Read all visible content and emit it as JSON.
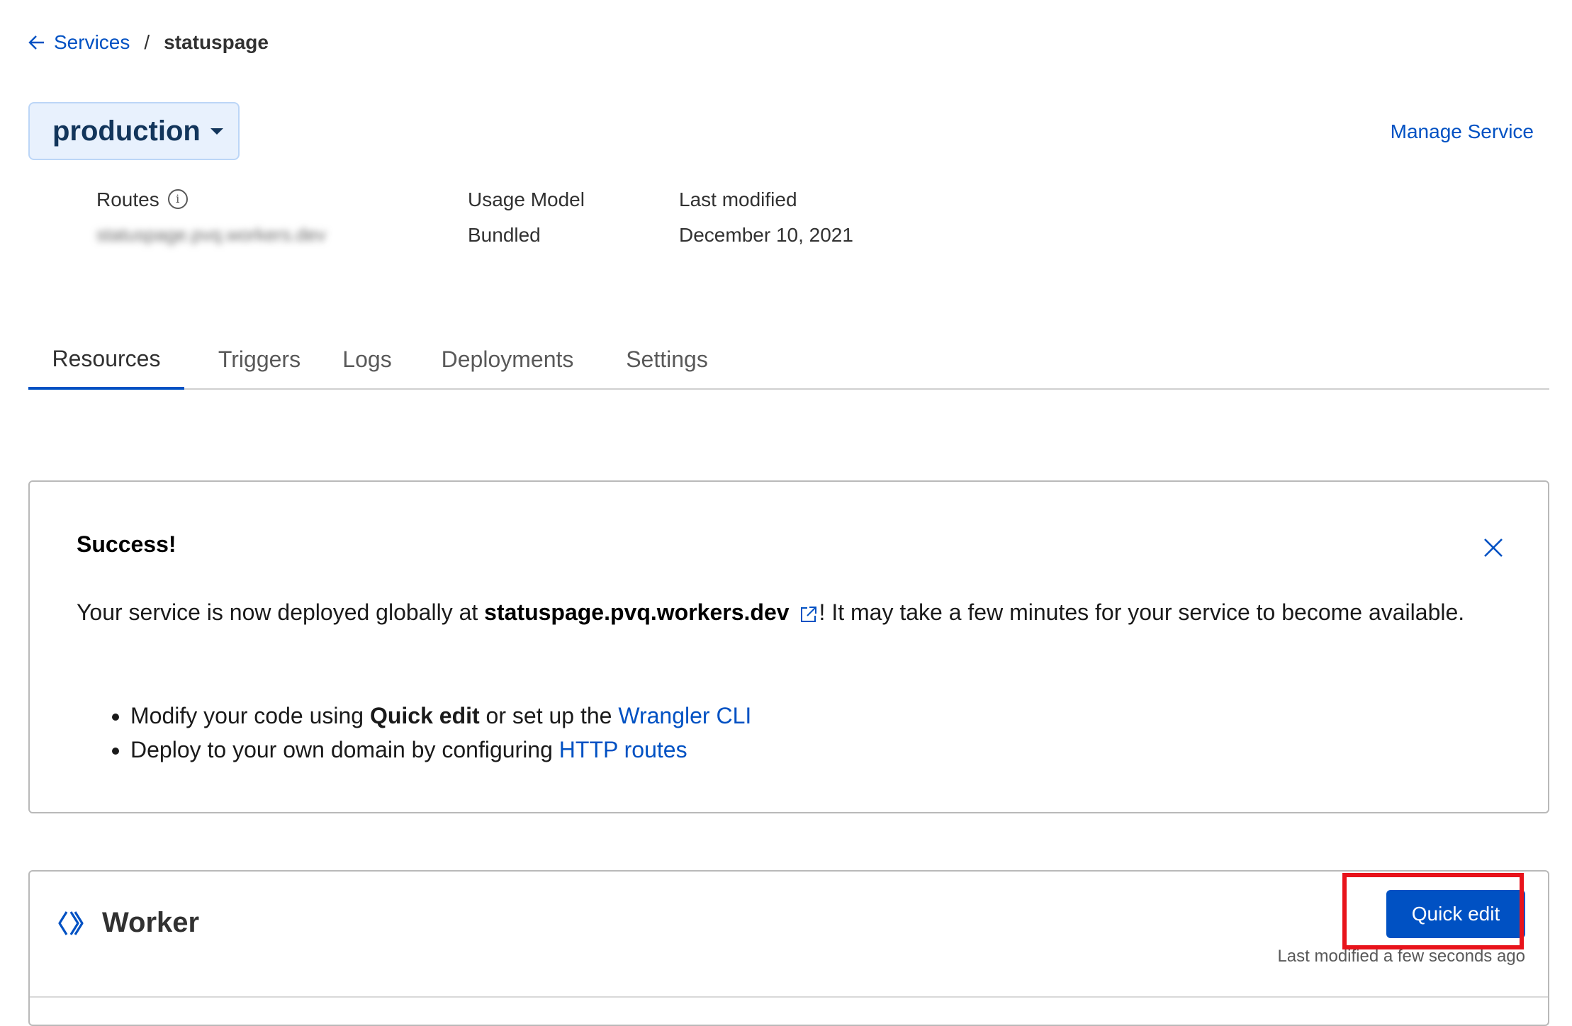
{
  "breadcrumb": {
    "back_label": "Services",
    "separator": "/",
    "current": "statuspage"
  },
  "environment": {
    "selected": "production"
  },
  "header": {
    "manage_link": "Manage Service"
  },
  "meta": {
    "routes_label": "Routes",
    "routes_value_blurred": "statuspage.pvq.workers.dev",
    "usage_model_label": "Usage Model",
    "usage_model_value": "Bundled",
    "last_modified_label": "Last modified",
    "last_modified_value": "December 10, 2021"
  },
  "tabs": [
    {
      "label": "Resources",
      "active": true
    },
    {
      "label": "Triggers",
      "active": false
    },
    {
      "label": "Logs",
      "active": false
    },
    {
      "label": "Deployments",
      "active": false
    },
    {
      "label": "Settings",
      "active": false
    }
  ],
  "alert": {
    "title": "Success!",
    "text_before": "Your service is now deployed globally at ",
    "domain": "statuspage.pvq.workers.dev",
    "text_after": "! It may take a few minutes for your service to become available.",
    "bullets": [
      {
        "before": "Modify your code using ",
        "bold": "Quick edit",
        "middle": " or set up the ",
        "link": "Wrangler CLI"
      },
      {
        "before": "Deploy to your own domain by configuring ",
        "link": "HTTP routes"
      }
    ]
  },
  "worker": {
    "title": "Worker",
    "quick_edit_label": "Quick edit",
    "last_modified": "Last modified a few seconds ago"
  },
  "colors": {
    "accent": "#0051c3",
    "highlight": "#e8131b",
    "env_bg": "#e8f1fd"
  },
  "icons": {
    "back": "arrow-left-icon",
    "info": "info-icon",
    "close": "close-icon",
    "external": "external-link-icon",
    "worker": "worker-chevrons-icon"
  }
}
